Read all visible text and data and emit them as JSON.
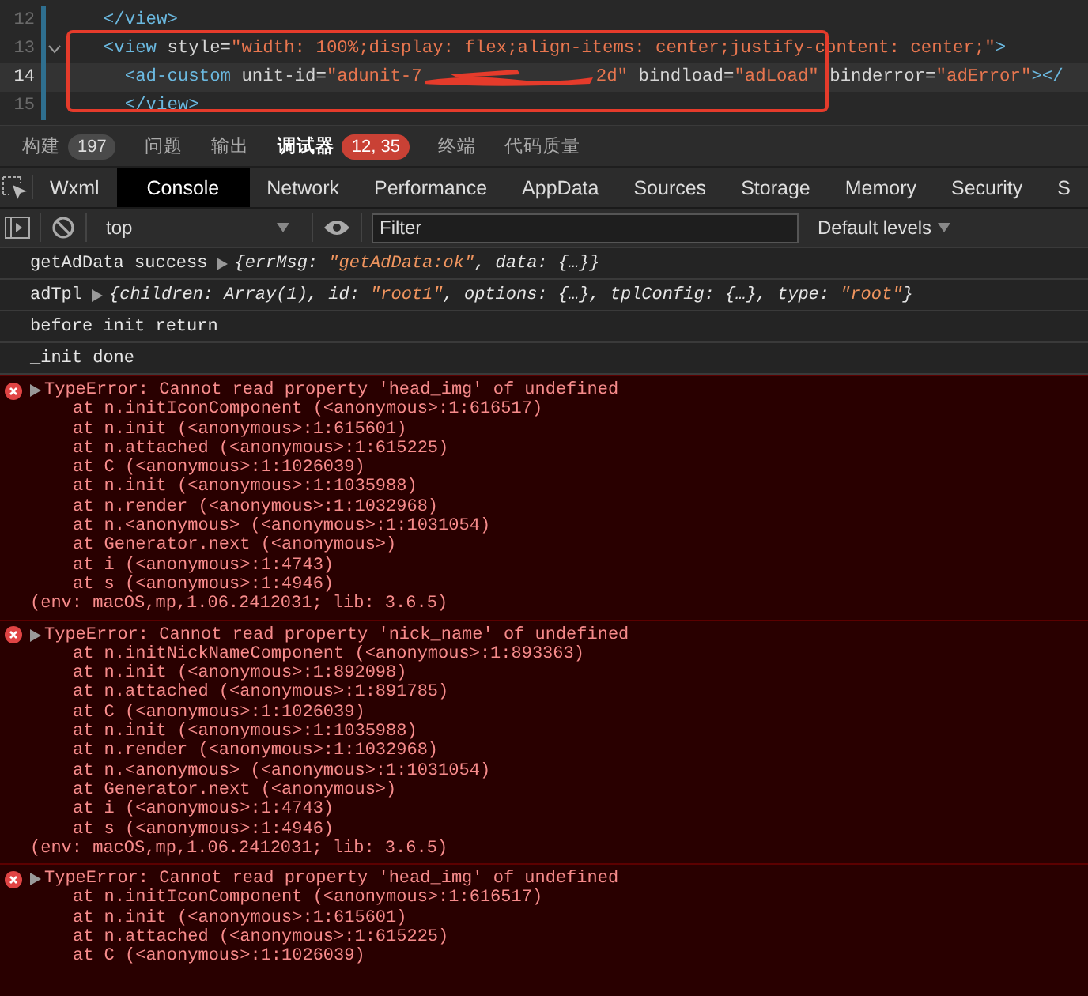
{
  "editor": {
    "lines": [
      {
        "number": "12",
        "current": false,
        "tokens": [
          {
            "kind": "tag",
            "t": "  </view>"
          }
        ]
      },
      {
        "number": "13",
        "expanded": true,
        "current": false,
        "tokens": [
          {
            "kind": "tag",
            "t": "  <view"
          },
          {
            "kind": "attr",
            "t": " style"
          },
          {
            "kind": "plain",
            "t": "="
          },
          {
            "kind": "str",
            "t": "\"width: 100%;display: flex;align-items: center;justify-content: center;\""
          },
          {
            "kind": "tag",
            "t": ">"
          }
        ]
      },
      {
        "number": "14",
        "current": true,
        "tokens": [
          {
            "kind": "tag",
            "t": "    <ad-custom"
          },
          {
            "kind": "attr",
            "t": " unit-id"
          },
          {
            "kind": "plain",
            "t": "="
          },
          {
            "kind": "str",
            "t": "\"adunit-7"
          },
          {
            "kind": "redacted"
          },
          {
            "kind": "str",
            "t": "2d\""
          },
          {
            "kind": "attr",
            "t": " bindload"
          },
          {
            "kind": "plain",
            "t": "="
          },
          {
            "kind": "str",
            "t": "\"adLoad\""
          },
          {
            "kind": "attr",
            "t": " binderror"
          },
          {
            "kind": "plain",
            "t": "="
          },
          {
            "kind": "str",
            "t": "\"adError\""
          },
          {
            "kind": "tag",
            "t": "></"
          }
        ]
      },
      {
        "number": "15",
        "current": false,
        "tokens": [
          {
            "kind": "tag",
            "t": "    </view>"
          }
        ]
      }
    ]
  },
  "panel_tabs": [
    {
      "label": "构建",
      "badge": "197",
      "kind": "count",
      "selected": false
    },
    {
      "label": "问题",
      "selected": false
    },
    {
      "label": "输出",
      "selected": false
    },
    {
      "label": "调试器",
      "badge": "12, 35",
      "kind": "error",
      "selected": true
    },
    {
      "label": "终端",
      "selected": false
    },
    {
      "label": "代码质量",
      "selected": false
    }
  ],
  "devtools_tabs": [
    {
      "label": "Wxml",
      "selected": false
    },
    {
      "label": "Console",
      "selected": true
    },
    {
      "label": "Network",
      "selected": false
    },
    {
      "label": "Performance",
      "selected": false
    },
    {
      "label": "AppData",
      "selected": false
    },
    {
      "label": "Sources",
      "selected": false
    },
    {
      "label": "Storage",
      "selected": false
    },
    {
      "label": "Memory",
      "selected": false
    },
    {
      "label": "Security",
      "selected": false
    },
    {
      "label": "S",
      "selected": false
    }
  ],
  "toolbar": {
    "context": "top",
    "filter": {
      "placeholder": "Filter"
    },
    "levels": "Default levels"
  },
  "messages": [
    {
      "kind": "log",
      "text": "getAdData success",
      "expanded": false,
      "object": [
        {
          "kind": "p",
          "t": "{errMsg: "
        },
        {
          "kind": "s",
          "t": "\"getAdData:ok\""
        },
        {
          "kind": "p",
          "t": ", data: {…}}"
        }
      ]
    },
    {
      "kind": "log",
      "text": "adTpl",
      "expanded": false,
      "object": [
        {
          "kind": "p",
          "t": "{children: Array(1), id: "
        },
        {
          "kind": "s",
          "t": "\"root1\""
        },
        {
          "kind": "p",
          "t": ", options: {…}, tplConfig: {…}, type: "
        },
        {
          "kind": "s",
          "t": "\"root\""
        },
        {
          "kind": "p",
          "t": "}"
        }
      ]
    },
    {
      "kind": "log",
      "text": "before init return"
    },
    {
      "kind": "log",
      "text": "_init done"
    },
    {
      "kind": "error",
      "expanded": false,
      "text": "TypeError: Cannot read property 'head_img' of undefined",
      "stack": [
        "at n.initIconComponent (<anonymous>:1:616517)",
        "at n.init (<anonymous>:1:615601)",
        "at n.attached (<anonymous>:1:615225)",
        "at C (<anonymous>:1:1026039)",
        "at n.init (<anonymous>:1:1035988)",
        "at n.render (<anonymous>:1:1032968)",
        "at n.<anonymous> (<anonymous>:1:1031054)",
        "at Generator.next (<anonymous>)",
        "at i (<anonymous>:1:4743)",
        "at s (<anonymous>:1:4946)"
      ],
      "env": "(env: macOS,mp,1.06.2412031; lib: 3.6.5)"
    },
    {
      "kind": "error",
      "expanded": false,
      "text": "TypeError: Cannot read property 'nick_name' of undefined",
      "stack": [
        "at n.initNickNameComponent (<anonymous>:1:893363)",
        "at n.init (<anonymous>:1:892098)",
        "at n.attached (<anonymous>:1:891785)",
        "at C (<anonymous>:1:1026039)",
        "at n.init (<anonymous>:1:1035988)",
        "at n.render (<anonymous>:1:1032968)",
        "at n.<anonymous> (<anonymous>:1:1031054)",
        "at Generator.next (<anonymous>)",
        "at i (<anonymous>:1:4743)",
        "at s (<anonymous>:1:4946)"
      ],
      "env": "(env: macOS,mp,1.06.2412031; lib: 3.6.5)"
    },
    {
      "kind": "error",
      "expanded": false,
      "text": "TypeError: Cannot read property 'head_img' of undefined",
      "stack": [
        "at n.initIconComponent (<anonymous>:1:616517)",
        "at n.init (<anonymous>:1:615601)",
        "at n.attached (<anonymous>:1:615225)",
        "at C (<anonymous>:1:1026039)"
      ]
    }
  ]
}
